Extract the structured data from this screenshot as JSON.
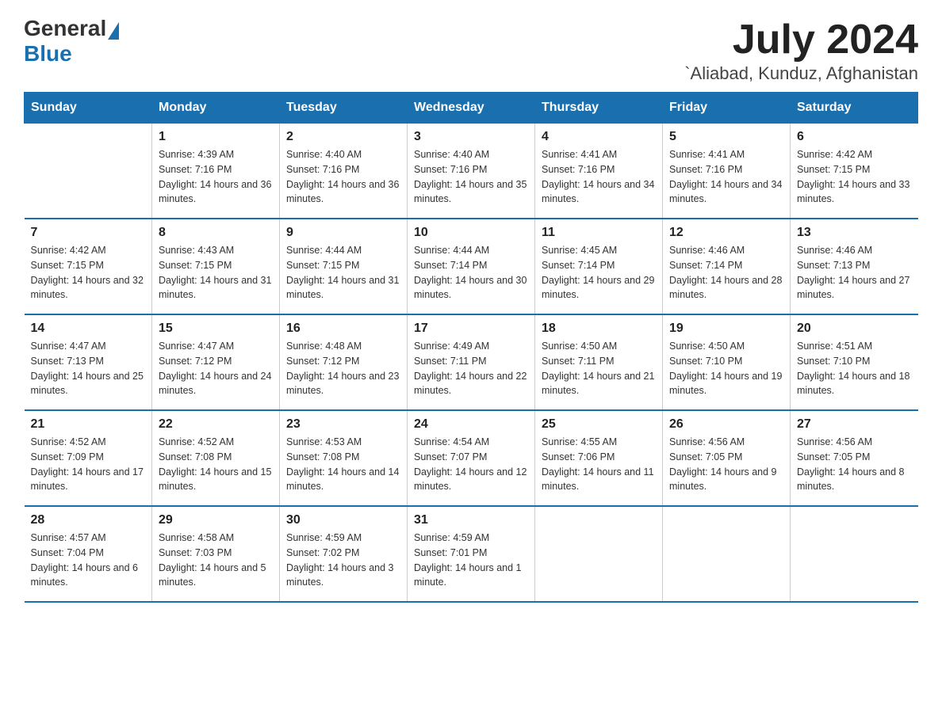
{
  "header": {
    "logo": {
      "general": "General",
      "blue": "Blue"
    },
    "title": "July 2024",
    "location": "`Aliabad, Kunduz, Afghanistan"
  },
  "weekdays": [
    "Sunday",
    "Monday",
    "Tuesday",
    "Wednesday",
    "Thursday",
    "Friday",
    "Saturday"
  ],
  "weeks": [
    [
      null,
      {
        "day": "1",
        "sunrise": "Sunrise: 4:39 AM",
        "sunset": "Sunset: 7:16 PM",
        "daylight": "Daylight: 14 hours and 36 minutes."
      },
      {
        "day": "2",
        "sunrise": "Sunrise: 4:40 AM",
        "sunset": "Sunset: 7:16 PM",
        "daylight": "Daylight: 14 hours and 36 minutes."
      },
      {
        "day": "3",
        "sunrise": "Sunrise: 4:40 AM",
        "sunset": "Sunset: 7:16 PM",
        "daylight": "Daylight: 14 hours and 35 minutes."
      },
      {
        "day": "4",
        "sunrise": "Sunrise: 4:41 AM",
        "sunset": "Sunset: 7:16 PM",
        "daylight": "Daylight: 14 hours and 34 minutes."
      },
      {
        "day": "5",
        "sunrise": "Sunrise: 4:41 AM",
        "sunset": "Sunset: 7:16 PM",
        "daylight": "Daylight: 14 hours and 34 minutes."
      },
      {
        "day": "6",
        "sunrise": "Sunrise: 4:42 AM",
        "sunset": "Sunset: 7:15 PM",
        "daylight": "Daylight: 14 hours and 33 minutes."
      }
    ],
    [
      {
        "day": "7",
        "sunrise": "Sunrise: 4:42 AM",
        "sunset": "Sunset: 7:15 PM",
        "daylight": "Daylight: 14 hours and 32 minutes."
      },
      {
        "day": "8",
        "sunrise": "Sunrise: 4:43 AM",
        "sunset": "Sunset: 7:15 PM",
        "daylight": "Daylight: 14 hours and 31 minutes."
      },
      {
        "day": "9",
        "sunrise": "Sunrise: 4:44 AM",
        "sunset": "Sunset: 7:15 PM",
        "daylight": "Daylight: 14 hours and 31 minutes."
      },
      {
        "day": "10",
        "sunrise": "Sunrise: 4:44 AM",
        "sunset": "Sunset: 7:14 PM",
        "daylight": "Daylight: 14 hours and 30 minutes."
      },
      {
        "day": "11",
        "sunrise": "Sunrise: 4:45 AM",
        "sunset": "Sunset: 7:14 PM",
        "daylight": "Daylight: 14 hours and 29 minutes."
      },
      {
        "day": "12",
        "sunrise": "Sunrise: 4:46 AM",
        "sunset": "Sunset: 7:14 PM",
        "daylight": "Daylight: 14 hours and 28 minutes."
      },
      {
        "day": "13",
        "sunrise": "Sunrise: 4:46 AM",
        "sunset": "Sunset: 7:13 PM",
        "daylight": "Daylight: 14 hours and 27 minutes."
      }
    ],
    [
      {
        "day": "14",
        "sunrise": "Sunrise: 4:47 AM",
        "sunset": "Sunset: 7:13 PM",
        "daylight": "Daylight: 14 hours and 25 minutes."
      },
      {
        "day": "15",
        "sunrise": "Sunrise: 4:47 AM",
        "sunset": "Sunset: 7:12 PM",
        "daylight": "Daylight: 14 hours and 24 minutes."
      },
      {
        "day": "16",
        "sunrise": "Sunrise: 4:48 AM",
        "sunset": "Sunset: 7:12 PM",
        "daylight": "Daylight: 14 hours and 23 minutes."
      },
      {
        "day": "17",
        "sunrise": "Sunrise: 4:49 AM",
        "sunset": "Sunset: 7:11 PM",
        "daylight": "Daylight: 14 hours and 22 minutes."
      },
      {
        "day": "18",
        "sunrise": "Sunrise: 4:50 AM",
        "sunset": "Sunset: 7:11 PM",
        "daylight": "Daylight: 14 hours and 21 minutes."
      },
      {
        "day": "19",
        "sunrise": "Sunrise: 4:50 AM",
        "sunset": "Sunset: 7:10 PM",
        "daylight": "Daylight: 14 hours and 19 minutes."
      },
      {
        "day": "20",
        "sunrise": "Sunrise: 4:51 AM",
        "sunset": "Sunset: 7:10 PM",
        "daylight": "Daylight: 14 hours and 18 minutes."
      }
    ],
    [
      {
        "day": "21",
        "sunrise": "Sunrise: 4:52 AM",
        "sunset": "Sunset: 7:09 PM",
        "daylight": "Daylight: 14 hours and 17 minutes."
      },
      {
        "day": "22",
        "sunrise": "Sunrise: 4:52 AM",
        "sunset": "Sunset: 7:08 PM",
        "daylight": "Daylight: 14 hours and 15 minutes."
      },
      {
        "day": "23",
        "sunrise": "Sunrise: 4:53 AM",
        "sunset": "Sunset: 7:08 PM",
        "daylight": "Daylight: 14 hours and 14 minutes."
      },
      {
        "day": "24",
        "sunrise": "Sunrise: 4:54 AM",
        "sunset": "Sunset: 7:07 PM",
        "daylight": "Daylight: 14 hours and 12 minutes."
      },
      {
        "day": "25",
        "sunrise": "Sunrise: 4:55 AM",
        "sunset": "Sunset: 7:06 PM",
        "daylight": "Daylight: 14 hours and 11 minutes."
      },
      {
        "day": "26",
        "sunrise": "Sunrise: 4:56 AM",
        "sunset": "Sunset: 7:05 PM",
        "daylight": "Daylight: 14 hours and 9 minutes."
      },
      {
        "day": "27",
        "sunrise": "Sunrise: 4:56 AM",
        "sunset": "Sunset: 7:05 PM",
        "daylight": "Daylight: 14 hours and 8 minutes."
      }
    ],
    [
      {
        "day": "28",
        "sunrise": "Sunrise: 4:57 AM",
        "sunset": "Sunset: 7:04 PM",
        "daylight": "Daylight: 14 hours and 6 minutes."
      },
      {
        "day": "29",
        "sunrise": "Sunrise: 4:58 AM",
        "sunset": "Sunset: 7:03 PM",
        "daylight": "Daylight: 14 hours and 5 minutes."
      },
      {
        "day": "30",
        "sunrise": "Sunrise: 4:59 AM",
        "sunset": "Sunset: 7:02 PM",
        "daylight": "Daylight: 14 hours and 3 minutes."
      },
      {
        "day": "31",
        "sunrise": "Sunrise: 4:59 AM",
        "sunset": "Sunset: 7:01 PM",
        "daylight": "Daylight: 14 hours and 1 minute."
      },
      null,
      null,
      null
    ]
  ]
}
